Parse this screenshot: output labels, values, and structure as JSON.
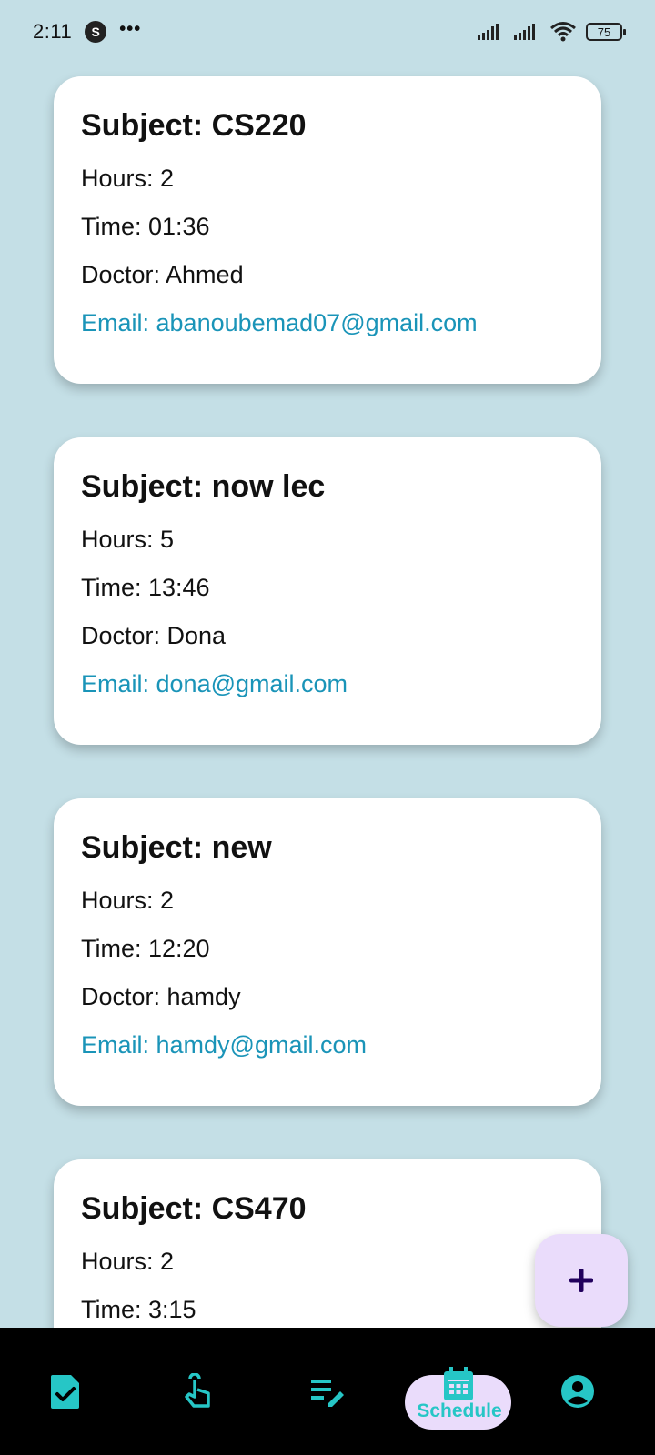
{
  "status_bar": {
    "time": "2:11",
    "app_badge": "S",
    "overflow": "•••",
    "battery": "75"
  },
  "cards": [
    {
      "subject": "Subject: CS220",
      "hours": "Hours: 2",
      "time": "Time: 01:36",
      "doctor": "Doctor: Ahmed",
      "email": "Email: abanoubemad07@gmail.com"
    },
    {
      "subject": "Subject: now lec",
      "hours": "Hours: 5",
      "time": "Time: 13:46",
      "doctor": "Doctor: Dona",
      "email": "Email: dona@gmail.com"
    },
    {
      "subject": "Subject: new",
      "hours": "Hours: 2",
      "time": "Time: 12:20",
      "doctor": "Doctor: hamdy",
      "email": "Email: hamdy@gmail.com"
    },
    {
      "subject": "Subject: CS470",
      "hours": "Hours: 2",
      "time": "Time: 3:15",
      "doctor": "",
      "email": ""
    }
  ],
  "fab": {
    "icon": "plus-icon"
  },
  "bottom_nav": {
    "items": [
      {
        "icon": "task-check-icon"
      },
      {
        "icon": "touch-gesture-icon"
      },
      {
        "icon": "edit-list-icon"
      },
      {
        "icon": "calendar-icon",
        "label": "Schedule",
        "selected": true
      },
      {
        "icon": "account-icon"
      }
    ]
  },
  "colors": {
    "background": "#c4dfe6",
    "card": "#ffffff",
    "email": "#1a94b8",
    "accent": "#26c6c6",
    "fab": "#eadcfb",
    "nav_bar": "#000000"
  }
}
